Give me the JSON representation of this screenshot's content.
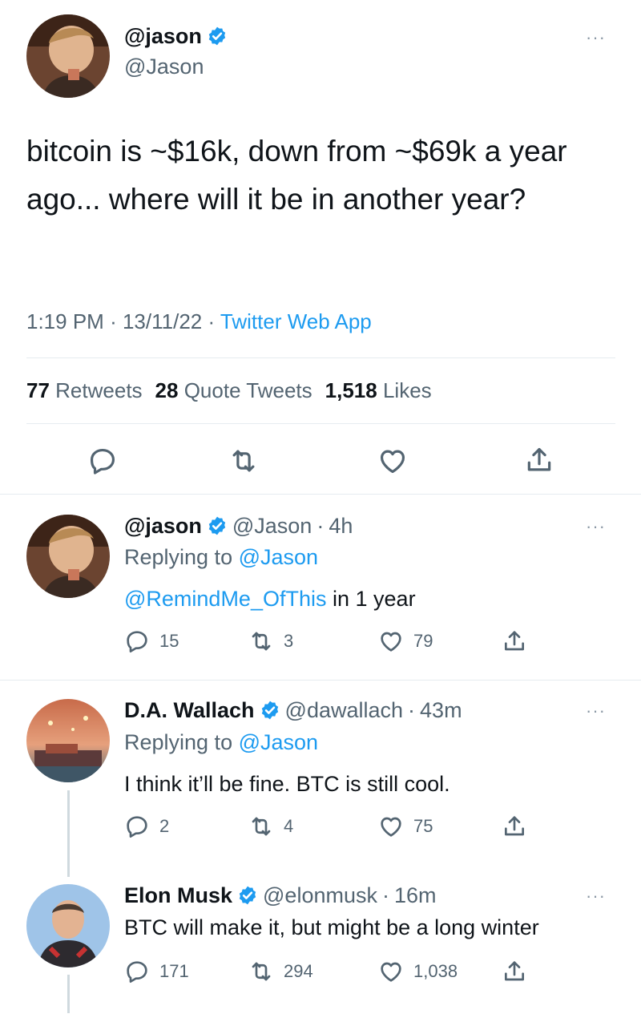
{
  "main_tweet": {
    "display_name": "@jason",
    "handle": "@Jason",
    "text": "bitcoin is ~$16k, down from ~$69k a year ago... where will it be in another year?",
    "time": "1:19 PM",
    "date": "13/11/22",
    "source": "Twitter Web App",
    "stats": {
      "retweets_count": "77",
      "retweets_label": "Retweets",
      "quotes_count": "28",
      "quotes_label": "Quote Tweets",
      "likes_count": "1,518",
      "likes_label": "Likes"
    }
  },
  "replies": [
    {
      "display_name": "@jason",
      "handle": "@Jason",
      "age": "4h",
      "replying_label": "Replying to",
      "replying_to": "@Jason",
      "mention": "@RemindMe_OfThis",
      "text": "in 1 year",
      "replies": "15",
      "retweets": "3",
      "likes": "79"
    },
    {
      "display_name": "D.A. Wallach",
      "handle": "@dawallach",
      "age": "43m",
      "replying_label": "Replying to",
      "replying_to": "@Jason",
      "text": "I think it’ll be fine. BTC is still cool.",
      "replies": "2",
      "retweets": "4",
      "likes": "75"
    },
    {
      "display_name": "Elon Musk",
      "handle": "@elonmusk",
      "age": "16m",
      "text": "BTC will make it, but might be a long winter",
      "replies": "171",
      "retweets": "294",
      "likes": "1,038"
    }
  ],
  "separator": "·",
  "more_glyph": "···",
  "colors": {
    "accent": "#1d9bf0",
    "text": "#0f1419",
    "secondary": "#536471"
  },
  "icons": [
    "verified-badge-icon",
    "reply-icon",
    "retweet-icon",
    "like-icon",
    "share-icon",
    "more-icon"
  ]
}
